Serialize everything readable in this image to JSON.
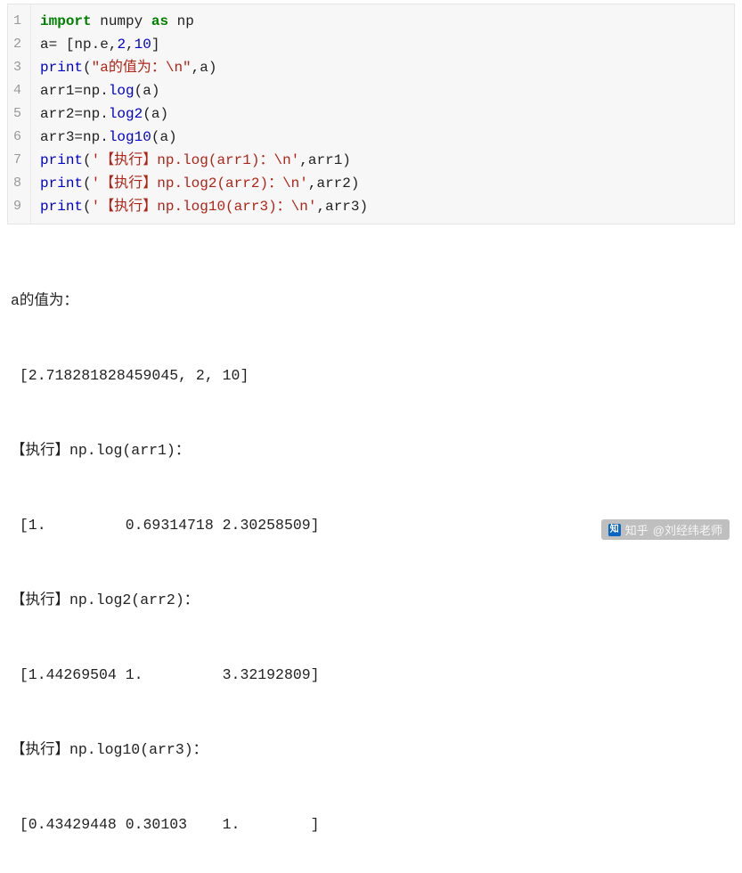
{
  "code": {
    "line_numbers": [
      "1",
      "2",
      "3",
      "4",
      "5",
      "6",
      "7",
      "8",
      "9"
    ],
    "l1": {
      "kw1": "import",
      "nm1": " numpy ",
      "kw2": "as",
      "nm2": " np"
    },
    "l2": {
      "t1": "a= [np.e,",
      "num1": "2",
      "t2": ",",
      "num2": "10",
      "t3": "]"
    },
    "l3": {
      "fn": "print",
      "op": "(",
      "str": "\"a的值为：\\n\"",
      "rest": ",a)"
    },
    "l4": {
      "t1": "arr1=np.",
      "fn": "log",
      "t2": "(a)"
    },
    "l5": {
      "t1": "arr2=np.",
      "fn": "log2",
      "t2": "(a)"
    },
    "l6": {
      "t1": "arr3=np.",
      "fn": "log10",
      "t2": "(a)"
    },
    "l7": {
      "fn": "print",
      "op": "(",
      "str": "'【执行】np.log(arr1)：\\n'",
      "rest": ",arr1)"
    },
    "l8": {
      "fn": "print",
      "op": "(",
      "str": "'【执行】np.log2(arr2)：\\n'",
      "rest": ",arr2)"
    },
    "l9": {
      "fn": "print",
      "op": "(",
      "str": "'【执行】np.log10(arr3)：\\n'",
      "rest": ",arr3)"
    }
  },
  "output": {
    "o1": "a的值为：",
    "o2": " [2.718281828459045, 2, 10]",
    "o3": "【执行】np.log(arr1)：",
    "o4": " [1.         0.69314718 2.30258509]",
    "o5": "【执行】np.log2(arr2)：",
    "o6": " [1.44269504 1.         3.32192809]",
    "o7": "【执行】np.log10(arr3)：",
    "o8": " [0.43429448 0.30103    1.        ]"
  },
  "watermark": {
    "platform": "知乎",
    "author": "@刘经纬老师"
  }
}
